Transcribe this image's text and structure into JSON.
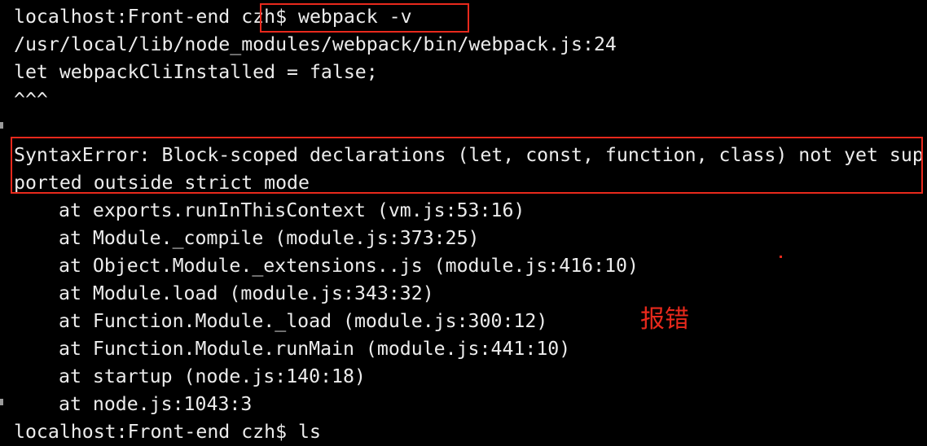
{
  "terminal": {
    "background": "#000000",
    "text_color": "#ececec",
    "lines": [
      "localhost:Front-end czh$ webpack -v",
      "/usr/local/lib/node_modules/webpack/bin/webpack.js:24",
      "let webpackCliInstalled = false;",
      "^^^",
      "",
      "SyntaxError: Block-scoped declarations (let, const, function, class) not yet sup",
      "ported outside strict mode",
      "at exports.runInThisContext (vm.js:53:16)",
      "at Module._compile (module.js:373:25)",
      "at Object.Module._extensions..js (module.js:416:10)",
      "at Module.load (module.js:343:32)",
      "at Function.Module._load (module.js:300:12)",
      "at Function.Module.runMain (module.js:441:10)",
      "at startup (node.js:140:18)",
      "at node.js:1043:3",
      "localhost:Front-end czh$ ls"
    ]
  },
  "annotation": {
    "text": "报错",
    "color": "#e8291c"
  }
}
